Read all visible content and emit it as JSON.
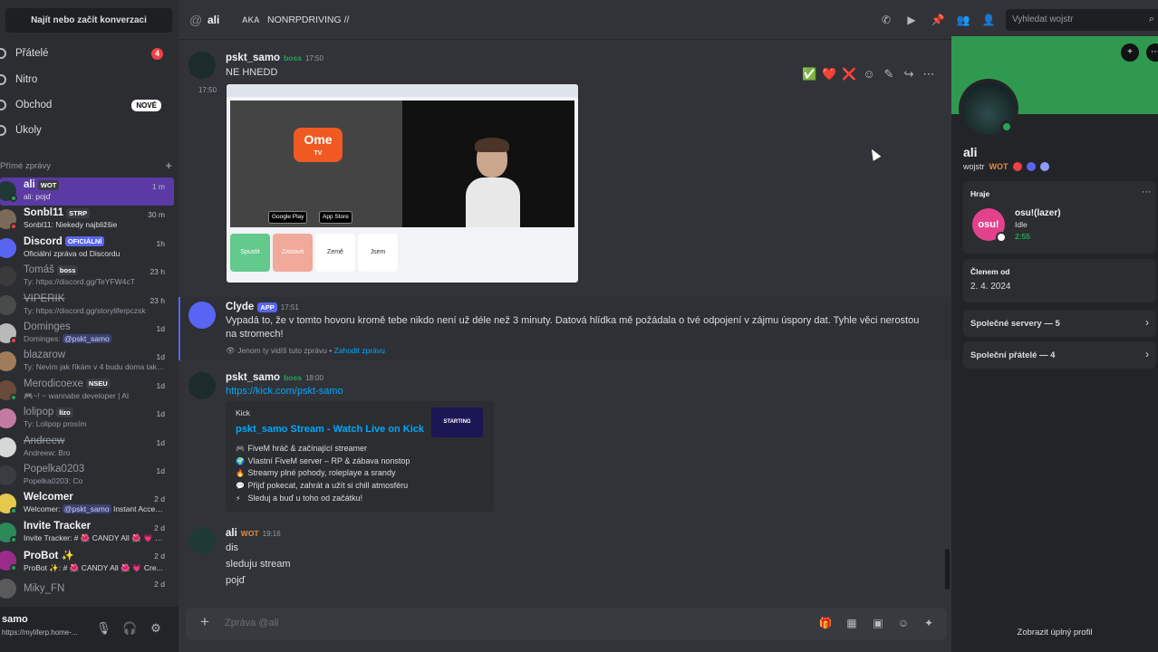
{
  "sidebar": {
    "search_label": "Najít nebo začít konverzaci",
    "nav": [
      {
        "label": "Přátelé",
        "badge": "4"
      },
      {
        "label": "Nitro"
      },
      {
        "label": "Obchod",
        "badge_new": "NOVÉ"
      },
      {
        "label": "Úkoly"
      }
    ],
    "dm_header": "Přímé zprávy",
    "dm_add": "+",
    "dms": [
      {
        "name": "ali",
        "tag": "WOT",
        "sub": "ali: pojď",
        "time": "1 m"
      },
      {
        "name": "Sonbl11",
        "tag": "STRP",
        "sub": "Sonbl11: Niekedy najbližšie",
        "time": "30 m"
      },
      {
        "name": "Discord",
        "tag": "OFICIÁLNÍ",
        "sub": "Oficiální zpráva od Discordu",
        "time": "1h"
      },
      {
        "name": "Tomáš",
        "tag": "boss",
        "sub": "Ty: https://discord.gg/TeYFW4cT",
        "time": "23 h"
      },
      {
        "name": "VIPERIK",
        "tag": "",
        "sub": "Ty: https://discord.gg/storyliferpczsk",
        "time": "23 h"
      },
      {
        "name": "Dominges",
        "tag": "",
        "sub_prefix": "Dominges:",
        "sub_mention": "@pskt_samo",
        "time": "1d"
      },
      {
        "name": "blazarow",
        "tag": "",
        "sub": "Ty: Nevim jak říkám v 4 budu doma takže...",
        "time": "1d"
      },
      {
        "name": "Merodicoexe",
        "tag": "NSEU",
        "sub": "🎮~! ~ wannabe developer | AI",
        "time": "1d"
      },
      {
        "name": "lolipop",
        "tag": "lízo",
        "sub": "Ty: Lolipop prosím",
        "time": "1d"
      },
      {
        "name": "Andreew",
        "tag": "",
        "sub": "Andreew: Bro",
        "time": "1d"
      },
      {
        "name": "Popelka0203",
        "tag": "",
        "sub": "Popelka0203: Co",
        "time": "1d"
      },
      {
        "name": "Welcomer",
        "tag": "",
        "sub_prefix": "Welcomer:",
        "sub_mention": "@pskt_samo",
        "sub_suffix": "Instant Access...",
        "time": "2 d"
      },
      {
        "name": "Invite Tracker",
        "tag": "",
        "sub": "Invite Tracker: # 🌺 CANDY All 🌺 💗 C...",
        "time": "2 d"
      },
      {
        "name": "ProBot ✨",
        "tag": "",
        "sub": "ProBot ✨: # 🌺 CANDY All 🌺 💗 Cre...",
        "time": "2 d"
      },
      {
        "name": "Miky_FN",
        "tag": "",
        "sub": "",
        "time": "2 d"
      }
    ],
    "user": {
      "name": "samo",
      "status": "https://myliferp.home-..."
    }
  },
  "topbar": {
    "channel": "ali",
    "aka_label": "AKA",
    "aka_value": "NONRPDRIVING //",
    "search_placeholder": "Vyhledat wojstr"
  },
  "messages": [
    {
      "author": "pskt_samo",
      "role": "boss",
      "time": "17:50",
      "text": "NE HNEDD",
      "side_time": "17:50"
    },
    {
      "author": "Clyde",
      "role": "APP",
      "time": "17:51",
      "text": "Vypadá to, že v tomto hovoru kromě tebe nikdo není už déle než 3 minuty. Datová hlídka mě požádala o tvé odpojení v zájmu úspory dat. Tyhle věci nerostou na stromech!",
      "ephemeral": "Jenom ty vidíš tuto zprávu •",
      "dismiss": "Zahodit zprávu"
    },
    {
      "author": "pskt_samo",
      "role": "boss",
      "time": "18:00",
      "link": "https://kick.com/pskt-samo"
    },
    {
      "author": "ali",
      "role": "WOT",
      "time": "19:16",
      "lines": [
        "dis",
        "sleduju stream",
        "pojď"
      ]
    }
  ],
  "screenshot_attachment": {
    "logo": "Ome",
    "logo_sub": "TV",
    "store1": "Google Play",
    "store2": "App Store",
    "btn_start": "Spustit",
    "btn_stop": "Zastavit",
    "btn_country": "Země",
    "btn_gender": "Jsem"
  },
  "embed": {
    "provider": "Kick",
    "title": "pskt_samo Stream - Watch Live on Kick",
    "thumb_text": "STARTING",
    "lines": [
      {
        "icon": "🎮",
        "text": "FiveM hráč & začínající streamer"
      },
      {
        "icon": "🌍",
        "text": "Vlastní FiveM server – RP & zábava nonstop"
      },
      {
        "icon": "🔥",
        "text": "Streamy plné pohody, roleplaye a srandy"
      },
      {
        "icon": "💬",
        "text": "Přijď pokecat, zahrát a užít si chill atmosféru"
      },
      {
        "icon": "⚡",
        "text": "Sleduj a buď u toho od začátku!"
      }
    ]
  },
  "hover_actions": [
    "✅",
    "❤️",
    "❌",
    "☺",
    "✎",
    "↪",
    "⋯"
  ],
  "composer": {
    "placeholder": "Zpráva @ali"
  },
  "profile": {
    "name": "ali",
    "username": "wojstr",
    "tag": "WOT",
    "activity_label": "Hraje",
    "game_icon": "osu!",
    "game_title": "osu!(lazer)",
    "game_state": "Idle",
    "game_time": "2:55",
    "member_label": "Členem od",
    "member_since": "2. 4. 2024",
    "mutual_servers": "Společné servery — 5",
    "mutual_friends": "Společní přátelé — 4",
    "full_profile": "Zobrazit úplný profil"
  },
  "colors": {
    "accent": "#5865f2",
    "online": "#23a55a",
    "banner": "#2f9a4f",
    "link": "#00a8fc",
    "active_dm": "#5b3aa6"
  }
}
